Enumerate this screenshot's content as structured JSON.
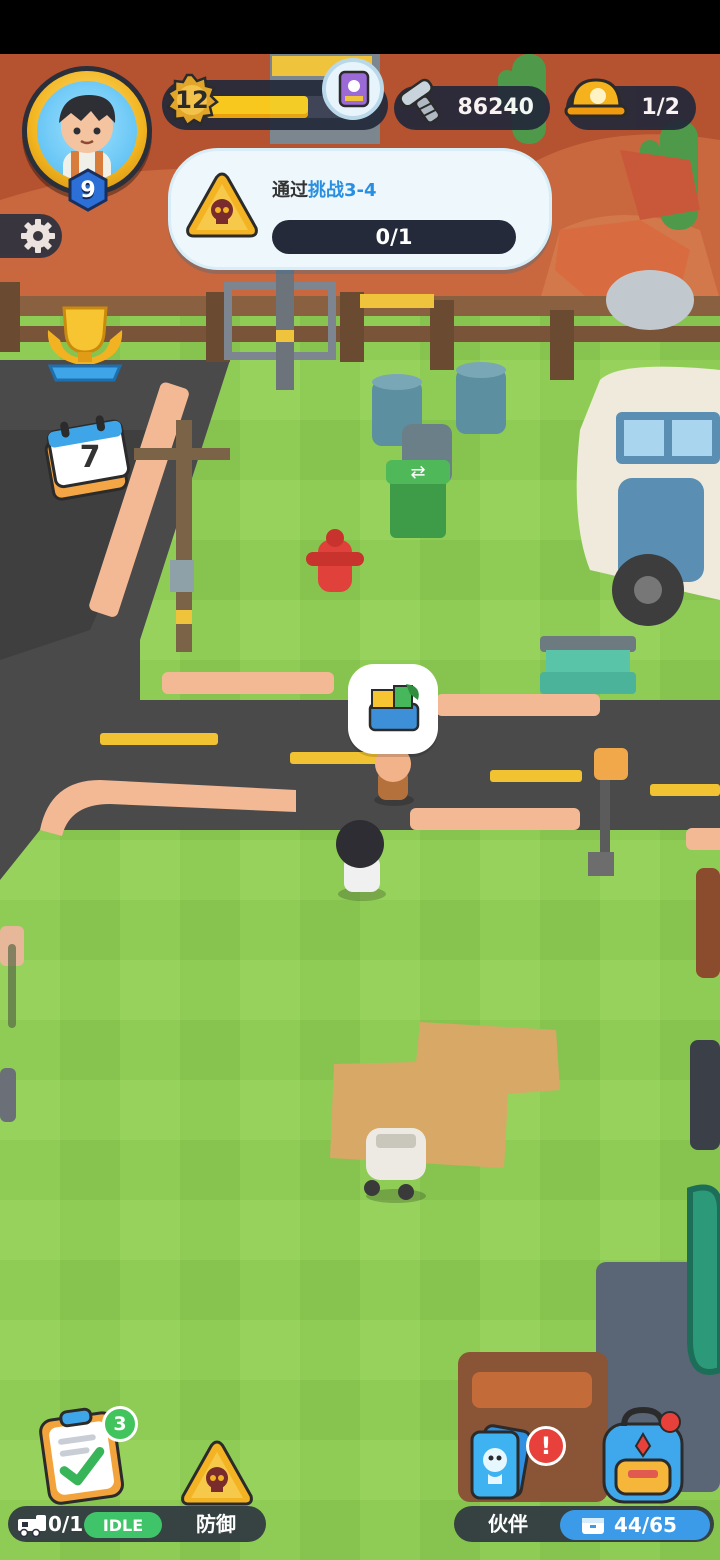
{
  "player": {
    "avatar_icon": "boy-avatar-icon",
    "player_level": "9",
    "base_level": "12",
    "xp_fraction": 0.72
  },
  "currency": {
    "bolts": "86240",
    "bolt_icon": "bolt-screw-icon",
    "workers": "1/2",
    "worker_icon": "hard-hat-icon"
  },
  "quest": {
    "title_prefix": "通过",
    "title_highlight": "挑战3-4",
    "progress_text": "0/1",
    "progress_fraction": 0,
    "icon": "skull-warning-icon"
  },
  "side_buttons": {
    "settings_icon": "gear-icon",
    "trophy_icon": "trophy-icon",
    "calendar_icon": "calendar-icon",
    "calendar_day": "7"
  },
  "npc_bubble_icon": "supply-crate-icon",
  "bottom_left": {
    "tasks_icon": "clipboard-check-icon",
    "tasks_badge": "3",
    "train_icon": "train-icon",
    "train_count": "0/1",
    "train_status": "IDLE",
    "defense_label": "防御",
    "defense_icon": "skull-warning-icon"
  },
  "bottom_right": {
    "partner_label": "伙伴",
    "partner_icon": "partner-card-icon",
    "partner_alert": "!",
    "backpack_icon": "backpack-icon",
    "storage_icon": "storage-box-icon",
    "storage_count": "44/65"
  },
  "colors": {
    "grass": "#8fcc55",
    "road": "#4a4a4a",
    "dirt": "#d8a866",
    "hud_dark": "#23293a",
    "accent_gold": "#ffd21e",
    "accent_blue": "#2a8fe0",
    "idle_green": "#40c46a"
  }
}
